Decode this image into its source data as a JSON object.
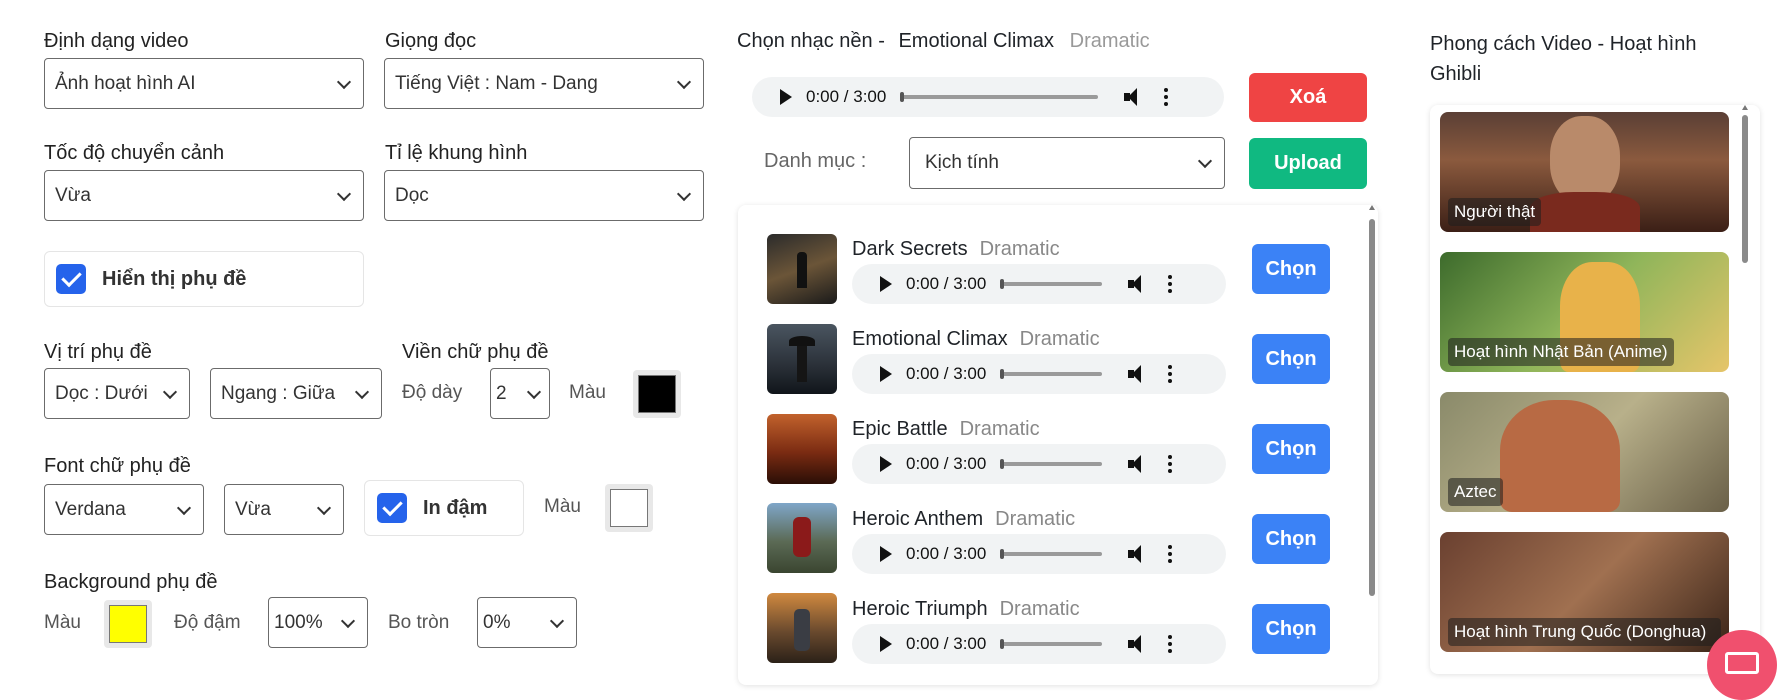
{
  "left": {
    "video_format": {
      "label": "Định dạng video",
      "value": "Ảnh hoạt hình AI"
    },
    "voice": {
      "label": "Giọng đọc",
      "value": "Tiếng Việt : Nam - Dang"
    },
    "transition_speed": {
      "label": "Tốc độ chuyển cảnh",
      "value": "Vừa"
    },
    "aspect_ratio": {
      "label": "Tỉ lệ khung hình",
      "value": "Dọc"
    },
    "show_subtitle": {
      "label": "Hiển thị phụ đề",
      "checked": true
    },
    "subtitle_position": {
      "label": "Vị trí phụ đề",
      "vertical": "Dọc : Dưới",
      "horizontal": "Ngang : Giữa"
    },
    "subtitle_border": {
      "label": "Viền chữ phụ đề",
      "thickness_label": "Độ dày",
      "thickness_value": "2",
      "color_label": "Màu",
      "color": "#000000"
    },
    "subtitle_font": {
      "label": "Font chữ phụ đề",
      "family": "Verdana",
      "size": "Vừa",
      "bold_label": "In đậm",
      "bold_checked": true,
      "color_label": "Màu",
      "color": "#ffffff"
    },
    "subtitle_background": {
      "label": "Background phụ đề",
      "color_label": "Màu",
      "color": "#ffff00",
      "opacity_label": "Độ đậm",
      "opacity_value": "100%",
      "radius_label": "Bo tròn",
      "radius_value": "0%"
    }
  },
  "music": {
    "header_prefix": "Chọn nhạc nền -",
    "selected_title": "Emotional Climax",
    "selected_genre": "Dramatic",
    "player_time": "0:00 / 3:00",
    "delete_label": "Xoá",
    "category_label": "Danh mục :",
    "category_value": "Kịch tính",
    "upload_label": "Upload",
    "choose_label": "Chọn",
    "songs": [
      {
        "title": "Dark Secrets",
        "genre": "Dramatic",
        "time": "0:00 / 3:00"
      },
      {
        "title": "Emotional Climax",
        "genre": "Dramatic",
        "time": "0:00 / 3:00"
      },
      {
        "title": "Epic Battle",
        "genre": "Dramatic",
        "time": "0:00 / 3:00"
      },
      {
        "title": "Heroic Anthem",
        "genre": "Dramatic",
        "time": "0:00 / 3:00"
      },
      {
        "title": "Heroic Triumph",
        "genre": "Dramatic",
        "time": "0:00 / 3:00"
      }
    ]
  },
  "styles": {
    "header": "Phong cách Video - Hoạt hình Ghibli",
    "items": [
      {
        "caption": "Người thật"
      },
      {
        "caption": "Hoạt hình Nhật Bản (Anime)"
      },
      {
        "caption": "Aztec"
      },
      {
        "caption": "Hoạt hình Trung Quốc (Donghua)"
      }
    ]
  },
  "colors": {
    "accent_blue": "#3b82f6",
    "delete_red": "#ef4444",
    "upload_green": "#10b981",
    "checkbox_blue": "#2563eb"
  }
}
